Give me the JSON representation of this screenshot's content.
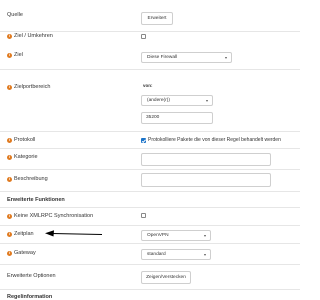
{
  "rows": {
    "quelle": {
      "label": "Quelle",
      "button": "Erweitert"
    },
    "ziel_umkehren": {
      "label": "Ziel / Umkehren",
      "checked": false
    },
    "ziel": {
      "label": "Ziel",
      "select": "Diese Firewall"
    },
    "zielportbereich": {
      "label": "Zielportbereich",
      "column_header": "von:",
      "select": "(andere(r))",
      "input": "35200"
    },
    "protokoll": {
      "label": "Protokoll",
      "checked": true,
      "checkbox_label": "Protokolliere Pakete die von dieser Regel behandelt werden"
    },
    "kategorie": {
      "label": "Kategorie",
      "input": ""
    },
    "beschreibung": {
      "label": "Beschreibung",
      "input": ""
    },
    "erweiterte_funktionen": {
      "label": "Erweiterte Funktionen"
    },
    "keine_xmlrpc": {
      "label": "Keine XMLRPC Synchronisation",
      "checked": false
    },
    "zeitplan": {
      "label": "Zeitplan",
      "select": "OpenVPN"
    },
    "gateway": {
      "label": "Gateway",
      "select": "standard"
    },
    "erweiterte_optionen": {
      "label": "Erweiterte Optionen",
      "button": "Zeigen/Verstecken"
    },
    "regelinformation": {
      "label": "Regelinformation"
    }
  },
  "icons": {
    "info": "info-icon",
    "arrow": "arrow-left-annotation"
  },
  "colors": {
    "info": "#e07a1f",
    "checkbox_checked": "#1a73c9",
    "arrow": "#000000"
  }
}
